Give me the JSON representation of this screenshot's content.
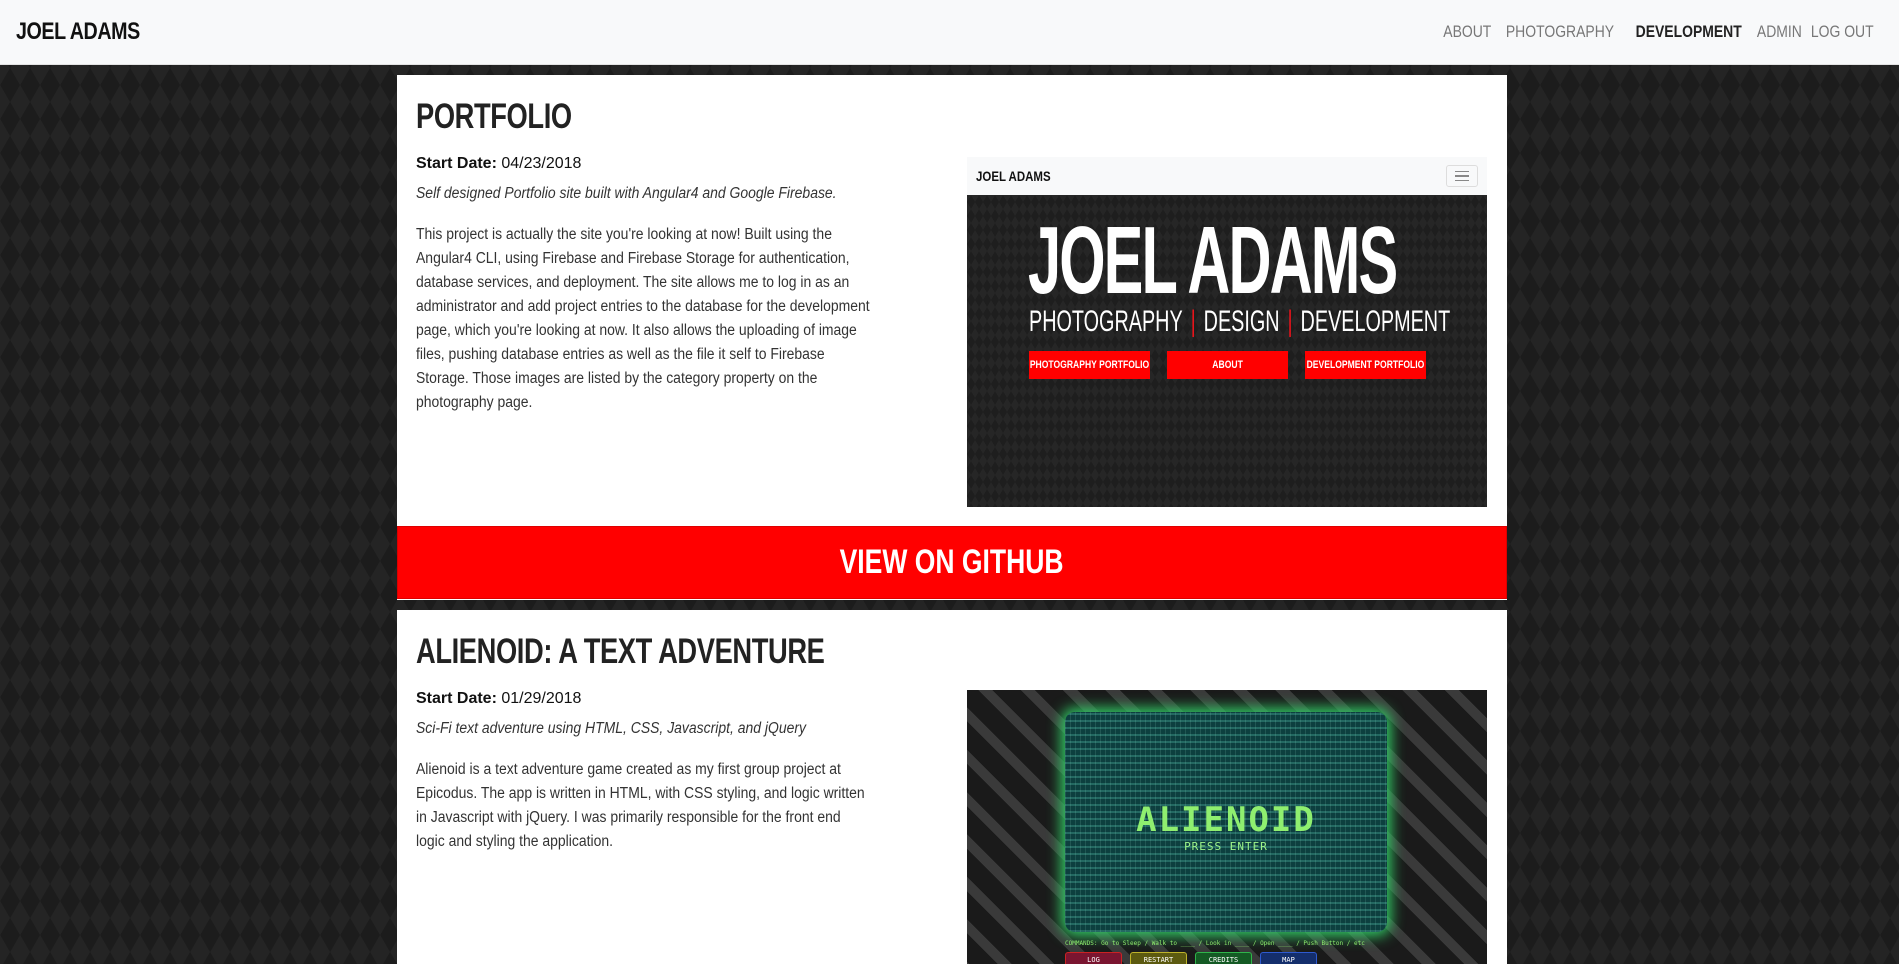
{
  "header": {
    "brand": "JOEL ADAMS",
    "nav": [
      {
        "label": "ABOUT",
        "active": false
      },
      {
        "label": "PHOTOGRAPHY",
        "active": false
      },
      {
        "label": "DEVELOPMENT",
        "active": true
      },
      {
        "label": "ADMIN",
        "active": false
      },
      {
        "label": "LOG OUT",
        "active": false
      }
    ]
  },
  "projects": [
    {
      "title": "PORTFOLIO",
      "start_label": "Start Date:",
      "start_date": "04/23/2018",
      "summary": "Self designed Portfolio site built with Angular4 and Google Firebase.",
      "description": "This project is actually the site you're looking at now! Built using the Angular4 CLI, using Firebase and Firebase Storage for authentication, database services, and deployment. The site allows me to log in as an administrator and add project entries to the database for the development page, which you're looking at now. It also allows the uploading of image files, pushing database entries as well as the file it self to Firebase Storage. Those images are listed by the category property on the photography page.",
      "screenshot": {
        "brand": "JOEL ADAMS",
        "hero_name": "JOEL ADAMS",
        "hero_sub": [
          "PHOTOGRAPHY",
          "|",
          "DESIGN",
          "|",
          "DEVELOPMENT"
        ],
        "buttons": [
          "PHOTOGRAPHY PORTFOLIO",
          "ABOUT",
          "DEVELOPMENT PORTFOLIO"
        ]
      },
      "github_label": "VIEW ON GITHUB"
    },
    {
      "title": "ALIENOID: A TEXT ADVENTURE",
      "start_label": "Start Date:",
      "start_date": "01/29/2018",
      "summary": "Sci-Fi text adventure using HTML, CSS, Javascript, and jQuery",
      "description": "Alienoid is a text adventure game created as my first group project at Epicodus. The app is written in HTML, with CSS styling, and logic written in Javascript with jQuery. I was primarily responsible for the front end logic and styling the application.",
      "screenshot": {
        "title": "ALIENOID",
        "press": "PRESS ENTER",
        "commands": "COMMANDS: Go to Sleep / Walk to ____ / Look in ____ / Open ____ / Push Button / etc",
        "buttons": [
          "LOG",
          "RESTART",
          "CREDITS",
          "MAP"
        ]
      }
    }
  ],
  "colors": {
    "accent": "#ff0000",
    "navbar_bg": "#f8f9fa",
    "page_bg": "#1c1c1c"
  }
}
